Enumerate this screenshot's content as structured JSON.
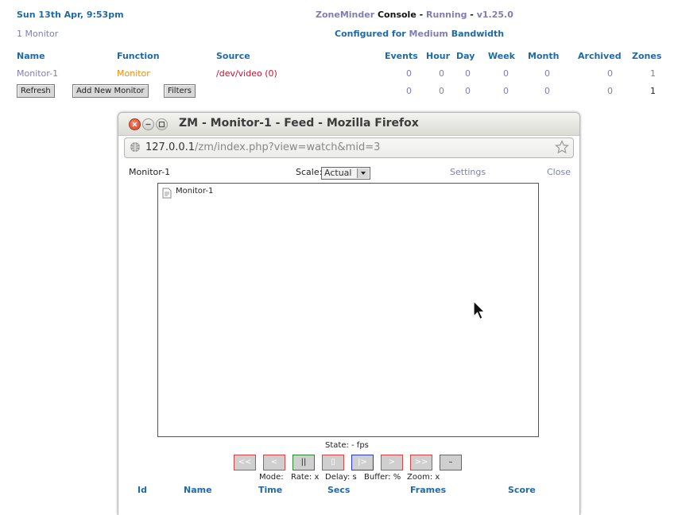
{
  "header": {
    "datetime": "Sun 13th Apr, 9:53pm",
    "app_name": "ZoneMinder",
    "console": "Console",
    "sep1": " - ",
    "status": "Running",
    "sep2": " - ",
    "version": "v1.25.0",
    "monitor_count": "1 Monitor",
    "configured_prefix": "Configured for",
    "bandwidth": "Medium",
    "bandwidth_suffix": "Bandwidth"
  },
  "table": {
    "columns": [
      "Name",
      "Function",
      "Source",
      "Events",
      "Hour",
      "Day",
      "Week",
      "Month",
      "Archived",
      "Zones"
    ],
    "rows": [
      {
        "name": "Monitor-1",
        "function": "Monitor",
        "source": "/dev/video (0)",
        "events": "0",
        "hour": "0",
        "day": "0",
        "week": "0",
        "month": "0",
        "archived": "0",
        "zones": "1"
      }
    ],
    "totals": {
      "events": "0",
      "hour": "0",
      "day": "0",
      "week": "0",
      "month": "0",
      "archived": "0",
      "zones": "1"
    }
  },
  "buttons": {
    "refresh": "Refresh",
    "add_monitor": "Add New Monitor",
    "filters": "Filters"
  },
  "popup": {
    "title": "ZM - Monitor-1 - Feed - Mozilla Firefox",
    "url_host": "127.0.0.1",
    "url_path": "/zm/index.php?view=watch&mid=3",
    "monitor_name": "Monitor-1",
    "scale_label": "Scale:",
    "scale_value": "Actual",
    "settings": "Settings",
    "close": "Close",
    "image_alt": "Monitor-1",
    "state": "State:  -  fps",
    "controls": [
      "<<",
      "<",
      "||",
      "▯",
      "|>",
      ">",
      ">>",
      "–"
    ],
    "mode": "Mode:",
    "rate": "Rate: x",
    "delay": "Delay: s",
    "buffer": "Buffer: %",
    "zoom": "Zoom: x",
    "events_columns": [
      "Id",
      "Name",
      "Time",
      "Secs",
      "Frames",
      "Score"
    ]
  },
  "colors": {
    "accent": "#1f6aa5",
    "function": "#e8900a",
    "source": "#c8102e",
    "lavender": "#7e7eb4"
  }
}
